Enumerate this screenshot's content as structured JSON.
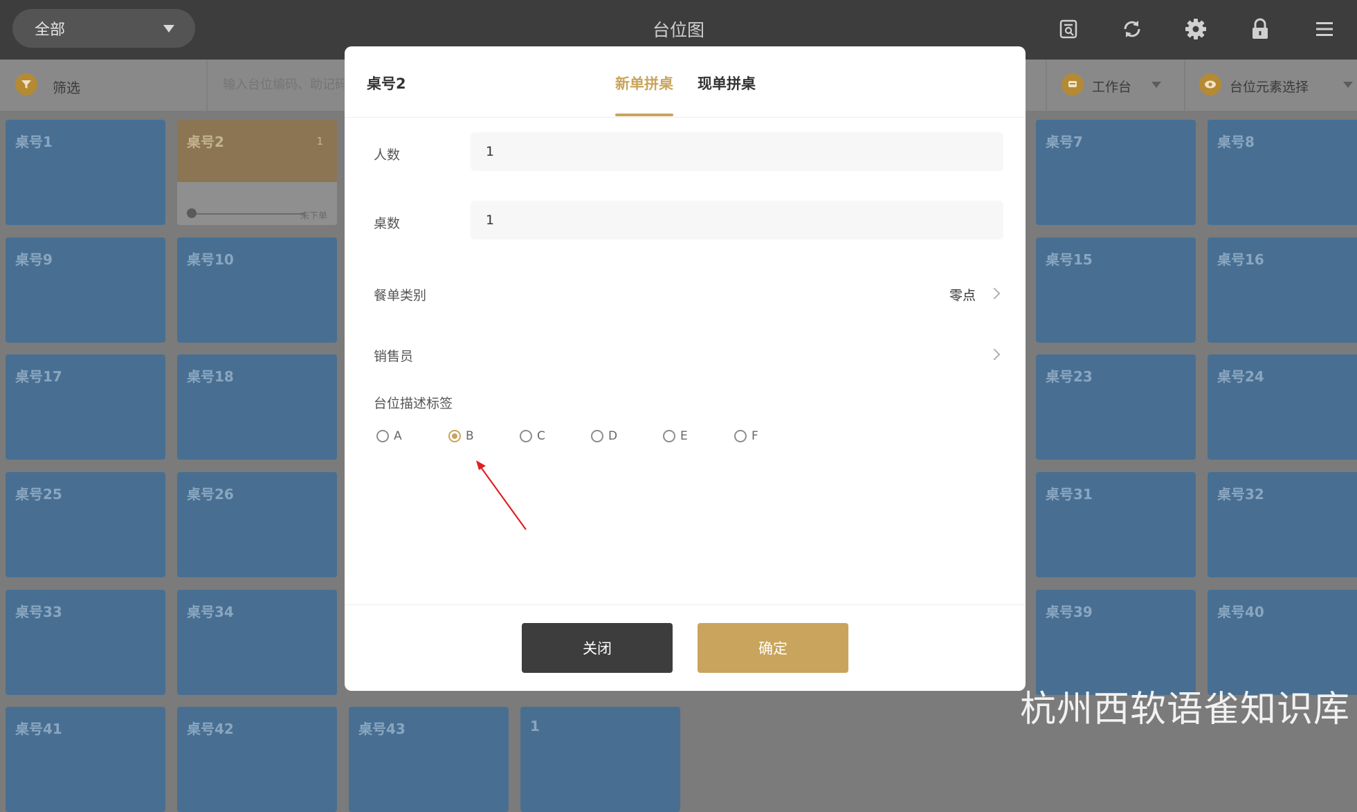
{
  "topbar": {
    "area_filter": "全部",
    "title": "台位图",
    "icons": [
      "search-doc-icon",
      "refresh-icon",
      "gear-icon",
      "lock-icon",
      "menu-icon"
    ]
  },
  "filterbar": {
    "filter_label": "筛选",
    "search_placeholder": "输入台位编码、助记码",
    "workbench_label": "工作台",
    "element_select_label": "台位元素选择"
  },
  "tables": [
    {
      "name": "桌号1"
    },
    {
      "name": "桌号2",
      "count": "1",
      "status": "未下单"
    },
    {
      "name": "桌号7"
    },
    {
      "name": "桌号8"
    },
    {
      "name": "桌号9"
    },
    {
      "name": "桌号10"
    },
    {
      "name": "桌号15"
    },
    {
      "name": "桌号16"
    },
    {
      "name": "桌号17"
    },
    {
      "name": "桌号18"
    },
    {
      "name": "桌号23"
    },
    {
      "name": "桌号24"
    },
    {
      "name": "桌号25"
    },
    {
      "name": "桌号26"
    },
    {
      "name": "桌号31"
    },
    {
      "name": "桌号32"
    },
    {
      "name": "桌号33"
    },
    {
      "name": "桌号34"
    },
    {
      "name": "桌号39"
    },
    {
      "name": "桌号40"
    },
    {
      "name": "桌号41"
    },
    {
      "name": "桌号42"
    },
    {
      "name": "桌号43"
    },
    {
      "name": "1"
    }
  ],
  "dialog": {
    "table_name": "桌号2",
    "tabs": [
      "新单拼桌",
      "现单拼桌"
    ],
    "active_tab": 0,
    "fields": {
      "guests_label": "人数",
      "guests_value": "1",
      "tables_label": "桌数",
      "tables_value": "1",
      "menu_category_label": "餐单类别",
      "menu_category_value": "零点",
      "salesperson_label": "销售员",
      "tag_label": "台位描述标签"
    },
    "tag_options": [
      "A",
      "B",
      "C",
      "D",
      "E",
      "F"
    ],
    "selected_tag": "B",
    "close_label": "关闭",
    "ok_label": "确定"
  },
  "watermark": "杭州西软语雀知识库",
  "colors": {
    "accent": "#c9a45c",
    "tile": "#486f92",
    "dark": "#3d3d3d"
  }
}
